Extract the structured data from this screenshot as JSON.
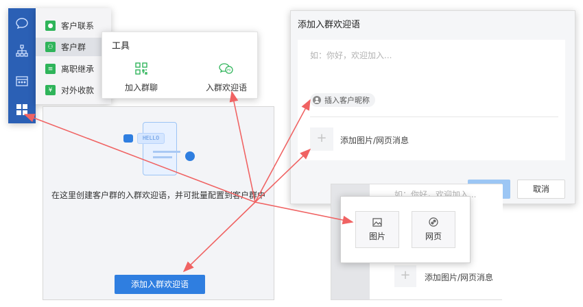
{
  "sidebar": {
    "items": [
      {
        "label": "客户联系",
        "color": "#2fb45a"
      },
      {
        "label": "客户群",
        "color": "#2fb45a"
      },
      {
        "label": "离职继承",
        "color": "#2fb45a"
      },
      {
        "label": "对外收款",
        "color": "#2fb45a"
      }
    ]
  },
  "tools": {
    "title": "工具",
    "join_group": "加入群聊",
    "welcome": "入群欢迎语"
  },
  "center": {
    "hello_text": "HELLO",
    "description": "在这里创建客户群的入群欢迎语，并可批量配置到客户群中",
    "add_button": "添加入群欢迎语"
  },
  "dialog": {
    "title": "添加入群欢迎语",
    "placeholder": "如：你好，欢迎加入...",
    "insert_nickname": "插入客户昵称",
    "add_media": "添加图片/网页消息",
    "cancel": "取消"
  },
  "mini": {
    "placeholder": "如：你好，欢迎加入...",
    "image": "图片",
    "webpage": "网页",
    "add_media": "添加图片/网页消息"
  },
  "colors": {
    "rail": "#2b60b5",
    "primary": "#2f7ee0",
    "green": "#2fb45a",
    "arrow": "#f06363"
  }
}
